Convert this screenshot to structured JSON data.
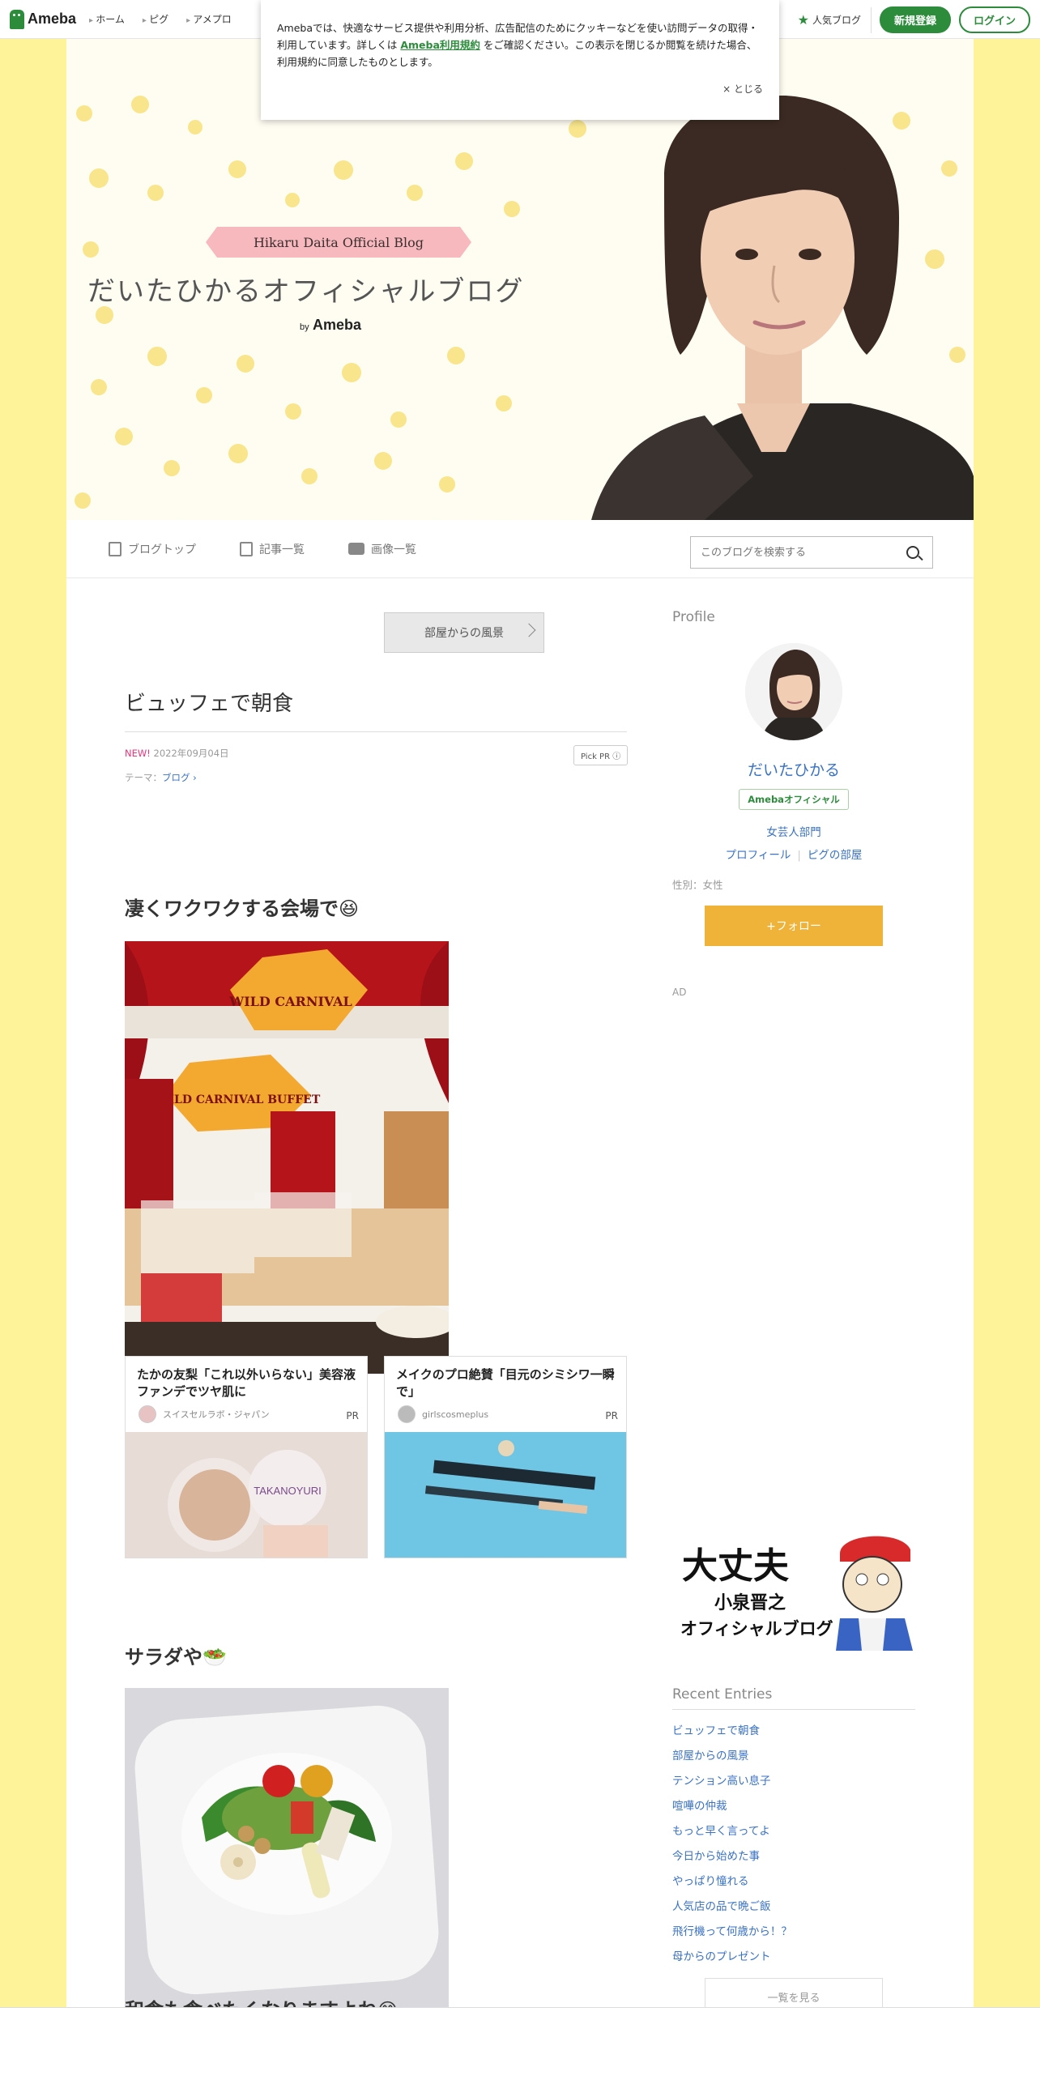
{
  "global_nav": {
    "logo": "Ameba",
    "items": [
      "ホーム",
      "ピグ",
      "アメプロ"
    ],
    "popular": "人気ブログ",
    "signup": "新規登録",
    "login": "ログイン"
  },
  "cookie_notice": {
    "text_before": "Amebaでは、快適なサービス提供や利用分析、広告配信のためにクッキーなどを使い訪問データの取得・利用しています。詳しくは ",
    "link": "Ameba利用規約",
    "text_after": " をご確認ください。この表示を閉じるか閲覧を続けた場合、利用規約に同意したものとします。",
    "close": "× とじる"
  },
  "header": {
    "ribbon": "Hikaru Daita Official Blog",
    "title": "だいたひかるオフィシャルブログ",
    "by": "by",
    "ameba": "Ameba"
  },
  "blog_nav": {
    "top": "ブログトップ",
    "entries": "記事一覧",
    "images": "画像一覧",
    "search_placeholder": "このブログを検索する"
  },
  "article": {
    "prev_label": "部屋からの風景",
    "title": "ビュッフェで朝食",
    "new": "NEW!",
    "date": "2022年09月04日",
    "pick_pr": "Pick PR ⓘ",
    "theme_label": "テーマ：",
    "theme": "ブログ",
    "heading1": "凄くワクワクする会場で😆",
    "heading2": "サラダや🥗",
    "heading3": "和食も食べたくなりますよね😊"
  },
  "ads": [
    {
      "title": "たかの友梨「これ以外いらない」美容液ファンデでツヤ肌に",
      "source": "スイスセルラボ・ジャパン",
      "pr": "PR"
    },
    {
      "title": "メイクのプロ絶賛「目元のシミシワ一瞬で」",
      "source": "girlscosmeplus",
      "pr": "PR"
    }
  ],
  "sidebar": {
    "profile_heading": "Profile",
    "name": "だいたひかる",
    "badge": "Amebaオフィシャル",
    "category": "女芸人部門",
    "profile_link": "プロフィール",
    "pigg_link": "ピグの部屋",
    "gender": "性別：女性",
    "follow": "+フォロー",
    "ad": "AD",
    "banner_line1": "大丈夫",
    "banner_line2": "小泉晋之",
    "banner_line3": "オフィシャルブログ",
    "recent_heading": "Recent Entries",
    "recent": [
      "ビュッフェで朝食",
      "部屋からの風景",
      "テンション高い息子",
      "喧嘩の仲裁",
      "もっと早く言ってよ",
      "今日から始めた事",
      "やっぱり憧れる",
      "人気店の品で晩ご飯",
      "飛行機って何歳から！？",
      "母からのプレゼント"
    ],
    "see_all": "一覧を見る"
  },
  "colors": {
    "brand_green": "#2d8c3c",
    "page_yellow": "#fff39a",
    "link_blue": "#3a72c4",
    "follow_orange": "#f0b33a",
    "new_pink": "#e5357b"
  }
}
